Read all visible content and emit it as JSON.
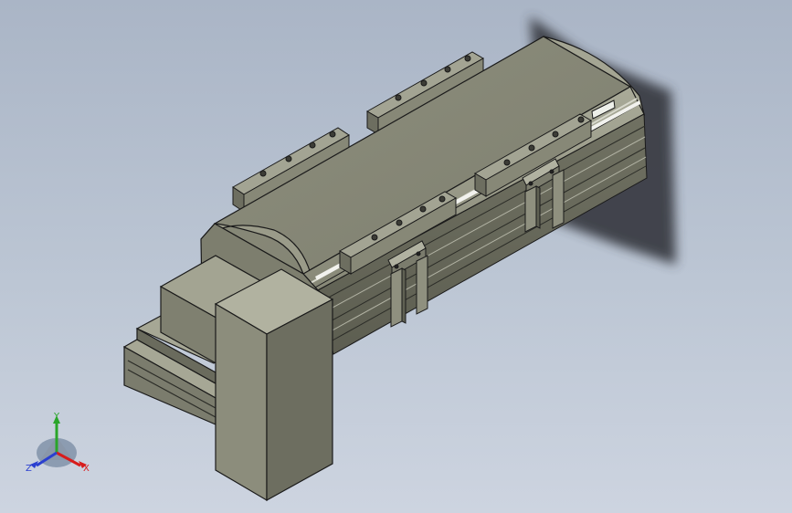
{
  "viewport": {
    "background_top": "#aab5c6",
    "background_bottom": "#cdd4e0"
  },
  "model": {
    "shaded_color": "#8f907f",
    "edge_color": "#1a1a1a",
    "shadow_color": "#3a3d44"
  },
  "triad": {
    "x_label": "X",
    "y_label": "Y",
    "z_label": "Z",
    "x_color": "#d81c1c",
    "y_color": "#2aa52a",
    "z_color": "#2a3fd0"
  }
}
